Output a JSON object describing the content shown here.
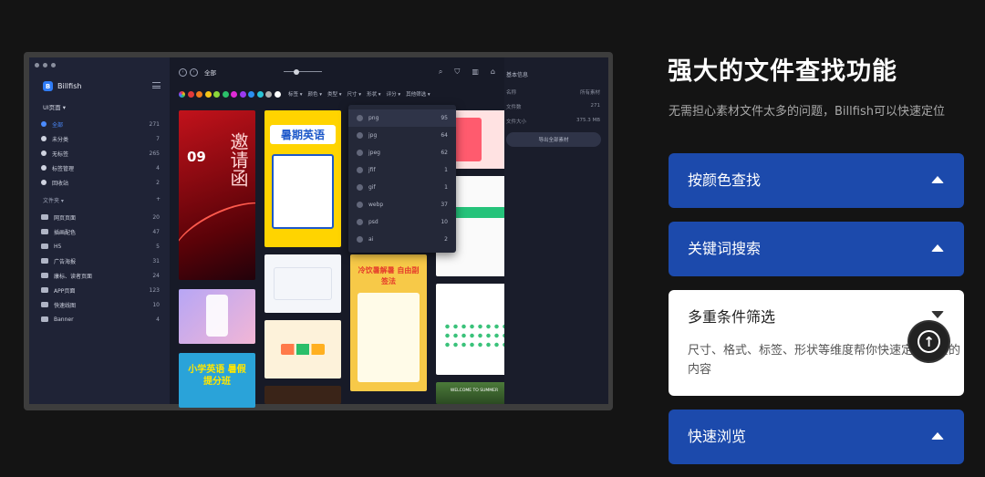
{
  "app": {
    "name": "Billfish",
    "library": "UI页面 ▾",
    "nav": [
      {
        "label": "全部",
        "count": "271",
        "active": true
      },
      {
        "label": "未分类",
        "count": "7"
      },
      {
        "label": "无标签",
        "count": "265"
      },
      {
        "label": "标签管理",
        "count": "4"
      },
      {
        "label": "回收站",
        "count": "2"
      }
    ],
    "folders_label": "文件夹 ▾",
    "folders_add": "+",
    "folders": [
      {
        "label": "网页页面",
        "count": "20"
      },
      {
        "label": "插画配色",
        "count": "47"
      },
      {
        "label": "H5",
        "count": "5"
      },
      {
        "label": "广告海报",
        "count": "31"
      },
      {
        "label": "康标、读者页面",
        "count": "24"
      },
      {
        "label": "APP页面",
        "count": "123"
      },
      {
        "label": "快速线图",
        "count": "10"
      },
      {
        "label": "Banner",
        "count": "4"
      }
    ],
    "breadcrumb": "全部",
    "swatch_colors": [
      "#e23a3a",
      "#f07b1d",
      "#f5c518",
      "#8bd63a",
      "#2bbf6a",
      "#e02bd6",
      "#9b3bf0",
      "#2b8ff0",
      "#29c3d6",
      "#b0b0b0",
      "#ffffff"
    ],
    "filters": [
      "标签 ▾",
      "颜色 ▾",
      "类型 ▾",
      "尺寸 ▾",
      "形状 ▾",
      "评分 ▾",
      "其他筛选 ▾"
    ],
    "format_menu": [
      {
        "label": "png",
        "count": "95"
      },
      {
        "label": "jpg",
        "count": "64"
      },
      {
        "label": "jpeg",
        "count": "62"
      },
      {
        "label": "jfif",
        "count": "1"
      },
      {
        "label": "gif",
        "count": "1"
      },
      {
        "label": "webp",
        "count": "37"
      },
      {
        "label": "psd",
        "count": "10"
      },
      {
        "label": "ai",
        "count": "2"
      }
    ],
    "info": {
      "title": "基本信息",
      "rows": [
        {
          "k": "名称",
          "v": "所有素材"
        },
        {
          "k": "文件数",
          "v": "271"
        },
        {
          "k": "文件大小",
          "v": "375.3 MB"
        }
      ],
      "button": "导出全部素材"
    },
    "thumbs": {
      "poster1_title": "邀请函",
      "poster1_date": "09",
      "poster2_title": "暑期英语",
      "poster3_title": "冷饮暑解暑 自由副签法",
      "poster4_title": "小学英语 暑假提分班",
      "poster5_title": "WELCOME TO SUMMER"
    }
  },
  "panel": {
    "headline": "强大的文件查找功能",
    "subtext": "无需担心素材文件太多的问题，Billfish可以快速定位",
    "items": [
      {
        "title": "按颜色查找"
      },
      {
        "title": "关键词搜索"
      },
      {
        "title": "多重条件筛选",
        "body": "尺寸、格式、标签、形状等维度帮你快速定位需要的内容"
      },
      {
        "title": "快速浏览"
      }
    ]
  }
}
